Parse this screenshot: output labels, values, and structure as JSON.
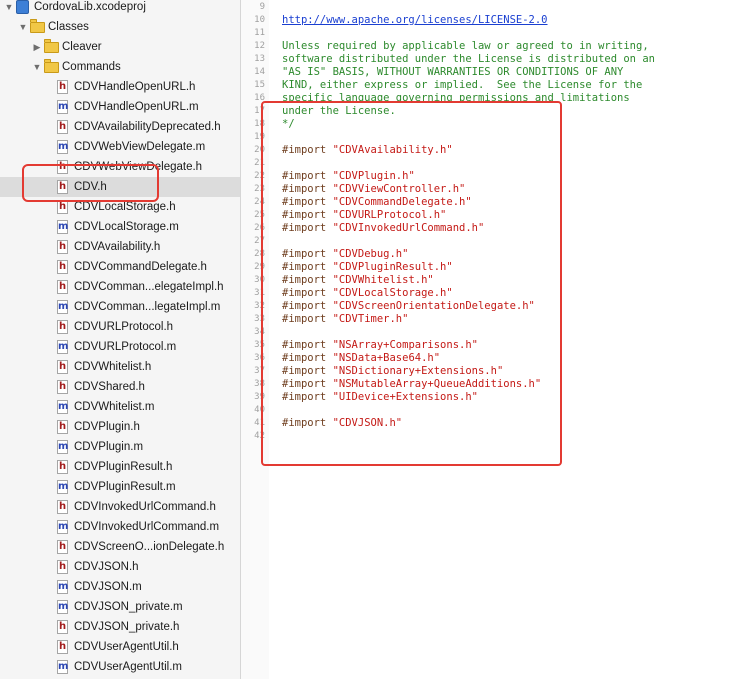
{
  "navigator": {
    "items": [
      {
        "label": "CordovaLib.xcodeproj",
        "type": "project",
        "disclosure": "expanded",
        "selected": false
      },
      {
        "label": "Classes",
        "type": "folder",
        "disclosure": "expanded",
        "selected": false
      },
      {
        "label": "Cleaver",
        "type": "folder",
        "disclosure": "collapsed",
        "selected": false
      },
      {
        "label": "Commands",
        "type": "folder",
        "disclosure": "expanded",
        "selected": false
      },
      {
        "label": "CDVHandleOpenURL.h",
        "type": "h",
        "selected": false
      },
      {
        "label": "CDVHandleOpenURL.m",
        "type": "m",
        "selected": false
      },
      {
        "label": "CDVAvailabilityDeprecated.h",
        "type": "h",
        "selected": false
      },
      {
        "label": "CDVWebViewDelegate.m",
        "type": "m",
        "selected": false
      },
      {
        "label": "CDVWebViewDelegate.h",
        "type": "h",
        "selected": false
      },
      {
        "label": "CDV.h",
        "type": "h",
        "selected": true
      },
      {
        "label": "CDVLocalStorage.h",
        "type": "h",
        "selected": false
      },
      {
        "label": "CDVLocalStorage.m",
        "type": "m",
        "selected": false
      },
      {
        "label": "CDVAvailability.h",
        "type": "h",
        "selected": false
      },
      {
        "label": "CDVCommandDelegate.h",
        "type": "h",
        "selected": false
      },
      {
        "label": "CDVComman...elegateImpl.h",
        "type": "h",
        "selected": false
      },
      {
        "label": "CDVComman...legateImpl.m",
        "type": "m",
        "selected": false
      },
      {
        "label": "CDVURLProtocol.h",
        "type": "h",
        "selected": false
      },
      {
        "label": "CDVURLProtocol.m",
        "type": "m",
        "selected": false
      },
      {
        "label": "CDVWhitelist.h",
        "type": "h",
        "selected": false
      },
      {
        "label": "CDVShared.h",
        "type": "h",
        "selected": false
      },
      {
        "label": "CDVWhitelist.m",
        "type": "m",
        "selected": false
      },
      {
        "label": "CDVPlugin.h",
        "type": "h",
        "selected": false
      },
      {
        "label": "CDVPlugin.m",
        "type": "m",
        "selected": false
      },
      {
        "label": "CDVPluginResult.h",
        "type": "h",
        "selected": false
      },
      {
        "label": "CDVPluginResult.m",
        "type": "m",
        "selected": false
      },
      {
        "label": "CDVInvokedUrlCommand.h",
        "type": "h",
        "selected": false
      },
      {
        "label": "CDVInvokedUrlCommand.m",
        "type": "m",
        "selected": false
      },
      {
        "label": "CDVScreenO...ionDelegate.h",
        "type": "h",
        "selected": false
      },
      {
        "label": "CDVJSON.h",
        "type": "h",
        "selected": false
      },
      {
        "label": "CDVJSON.m",
        "type": "m",
        "selected": false
      },
      {
        "label": "CDVJSON_private.m",
        "type": "m",
        "selected": false
      },
      {
        "label": "CDVJSON_private.h",
        "type": "h",
        "selected": false
      },
      {
        "label": "CDVUserAgentUtil.h",
        "type": "h",
        "selected": false
      },
      {
        "label": "CDVUserAgentUtil.m",
        "type": "m",
        "selected": false
      }
    ]
  },
  "editor": {
    "lines": [
      {
        "n": "9",
        "kind": "blank",
        "text": ""
      },
      {
        "n": "10",
        "kind": "link",
        "text": "http://www.apache.org/licenses/LICENSE-2.0"
      },
      {
        "n": "11",
        "kind": "blank",
        "text": ""
      },
      {
        "n": "12",
        "kind": "comment",
        "text": "Unless required by applicable law or agreed to in writing,"
      },
      {
        "n": "13",
        "kind": "comment",
        "text": "software distributed under the License is distributed on an"
      },
      {
        "n": "14",
        "kind": "comment",
        "text": "\"AS IS\" BASIS, WITHOUT WARRANTIES OR CONDITIONS OF ANY"
      },
      {
        "n": "15",
        "kind": "comment",
        "text": "KIND, either express or implied.  See the License for the"
      },
      {
        "n": "16",
        "kind": "comment",
        "text": "specific language governing permissions and limitations"
      },
      {
        "n": "17",
        "kind": "comment",
        "text": "under the License."
      },
      {
        "n": "18",
        "kind": "comment",
        "text": "*/"
      },
      {
        "n": "19",
        "kind": "blank",
        "text": ""
      },
      {
        "n": "20",
        "kind": "import",
        "kw": "#import",
        "str": "\"CDVAvailability.h\""
      },
      {
        "n": "21",
        "kind": "blank",
        "text": ""
      },
      {
        "n": "22",
        "kind": "import",
        "kw": "#import",
        "str": "\"CDVPlugin.h\""
      },
      {
        "n": "23",
        "kind": "import",
        "kw": "#import",
        "str": "\"CDVViewController.h\""
      },
      {
        "n": "24",
        "kind": "import",
        "kw": "#import",
        "str": "\"CDVCommandDelegate.h\""
      },
      {
        "n": "25",
        "kind": "import",
        "kw": "#import",
        "str": "\"CDVURLProtocol.h\""
      },
      {
        "n": "26",
        "kind": "import",
        "kw": "#import",
        "str": "\"CDVInvokedUrlCommand.h\""
      },
      {
        "n": "27",
        "kind": "blank",
        "text": ""
      },
      {
        "n": "28",
        "kind": "import",
        "kw": "#import",
        "str": "\"CDVDebug.h\""
      },
      {
        "n": "29",
        "kind": "import",
        "kw": "#import",
        "str": "\"CDVPluginResult.h\""
      },
      {
        "n": "30",
        "kind": "import",
        "kw": "#import",
        "str": "\"CDVWhitelist.h\""
      },
      {
        "n": "31",
        "kind": "import",
        "kw": "#import",
        "str": "\"CDVLocalStorage.h\""
      },
      {
        "n": "32",
        "kind": "import",
        "kw": "#import",
        "str": "\"CDVScreenOrientationDelegate.h\""
      },
      {
        "n": "33",
        "kind": "import",
        "kw": "#import",
        "str": "\"CDVTimer.h\""
      },
      {
        "n": "34",
        "kind": "blank",
        "text": ""
      },
      {
        "n": "35",
        "kind": "import",
        "kw": "#import",
        "str": "\"NSArray+Comparisons.h\""
      },
      {
        "n": "36",
        "kind": "import",
        "kw": "#import",
        "str": "\"NSData+Base64.h\""
      },
      {
        "n": "37",
        "kind": "import",
        "kw": "#import",
        "str": "\"NSDictionary+Extensions.h\""
      },
      {
        "n": "38",
        "kind": "import",
        "kw": "#import",
        "str": "\"NSMutableArray+QueueAdditions.h\""
      },
      {
        "n": "39",
        "kind": "import",
        "kw": "#import",
        "str": "\"UIDevice+Extensions.h\""
      },
      {
        "n": "40",
        "kind": "blank",
        "text": ""
      },
      {
        "n": "41",
        "kind": "import",
        "kw": "#import",
        "str": "\"CDVJSON.h\""
      },
      {
        "n": "42",
        "kind": "blank",
        "text": ""
      }
    ]
  },
  "colors": {
    "callout": "#e33a32",
    "comment": "#2d8a2d",
    "string": "#c41a16",
    "keyword": "#6f3e1f",
    "link": "#1a3fd1",
    "h_icon": "#a21c1c",
    "m_icon": "#2c47b3",
    "folder": "#f1c746"
  }
}
